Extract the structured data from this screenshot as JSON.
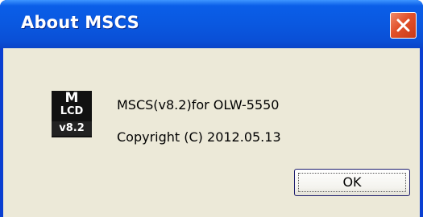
{
  "window": {
    "title": "About MSCS",
    "close_icon": "close-icon"
  },
  "app_icon": {
    "letter": "M",
    "lcd": "LCD",
    "version": "v8.2"
  },
  "info": {
    "line1": "MSCS(v8.2)for OLW-5550",
    "line2": "Copyright (C) 2012.05.13"
  },
  "buttons": {
    "ok_label": "OK"
  },
  "colors": {
    "titlebar": "#0a58e0",
    "client": "#ece9d8",
    "close_button": "#e1502a"
  }
}
